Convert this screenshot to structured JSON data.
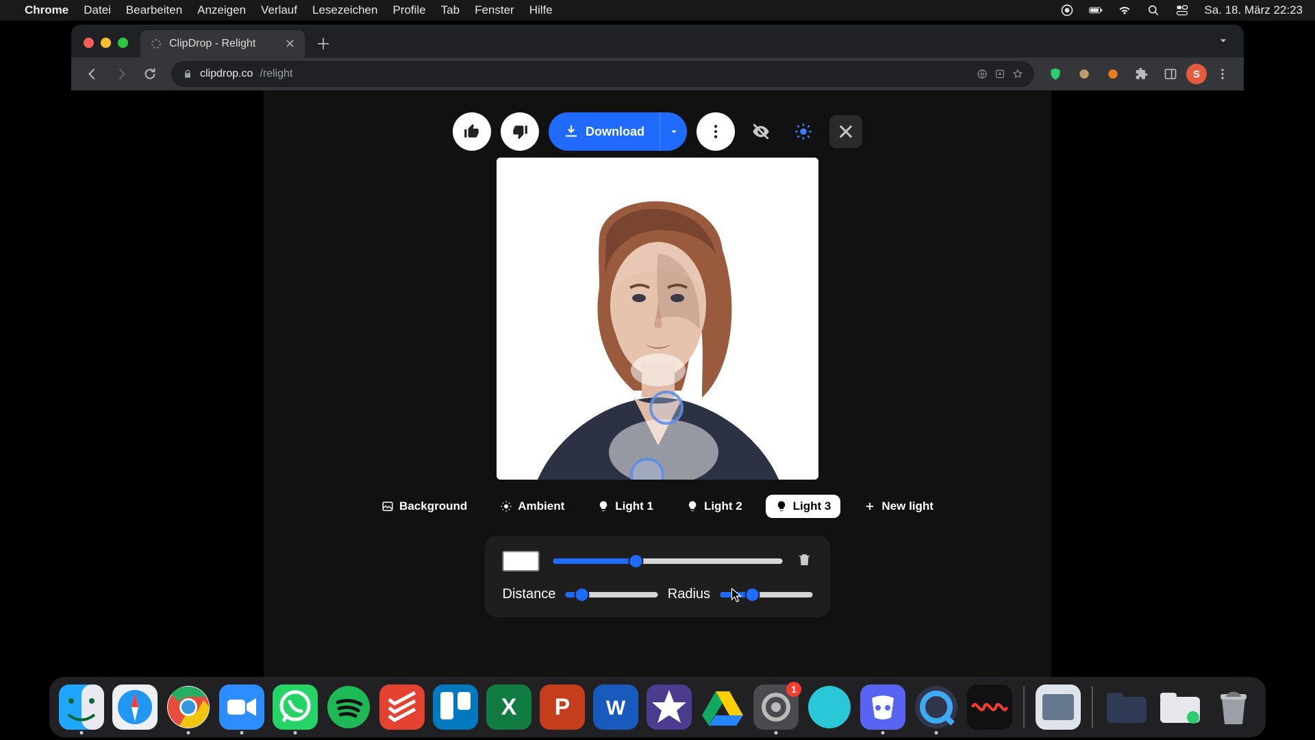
{
  "menubar": {
    "app": "Chrome",
    "items": [
      "Datei",
      "Bearbeiten",
      "Anzeigen",
      "Verlauf",
      "Lesezeichen",
      "Profile",
      "Tab",
      "Fenster",
      "Hilfe"
    ],
    "clock": "Sa. 18. März  22:23"
  },
  "browser": {
    "tab_title": "ClipDrop - Relight",
    "url_host": "clipdrop.co",
    "url_path": "/relight",
    "avatar_initial": "S"
  },
  "actions": {
    "download": "Download"
  },
  "tabs": {
    "background": "Background",
    "ambient": "Ambient",
    "light1": "Light 1",
    "light2": "Light 2",
    "light3": "Light 3",
    "newlight": "New light"
  },
  "controls": {
    "intensity_pct": 36,
    "distance_label": "Distance",
    "distance_pct": 18,
    "radius_label": "Radius",
    "radius_pct": 35
  },
  "dock": {
    "settings_badge": "1"
  }
}
